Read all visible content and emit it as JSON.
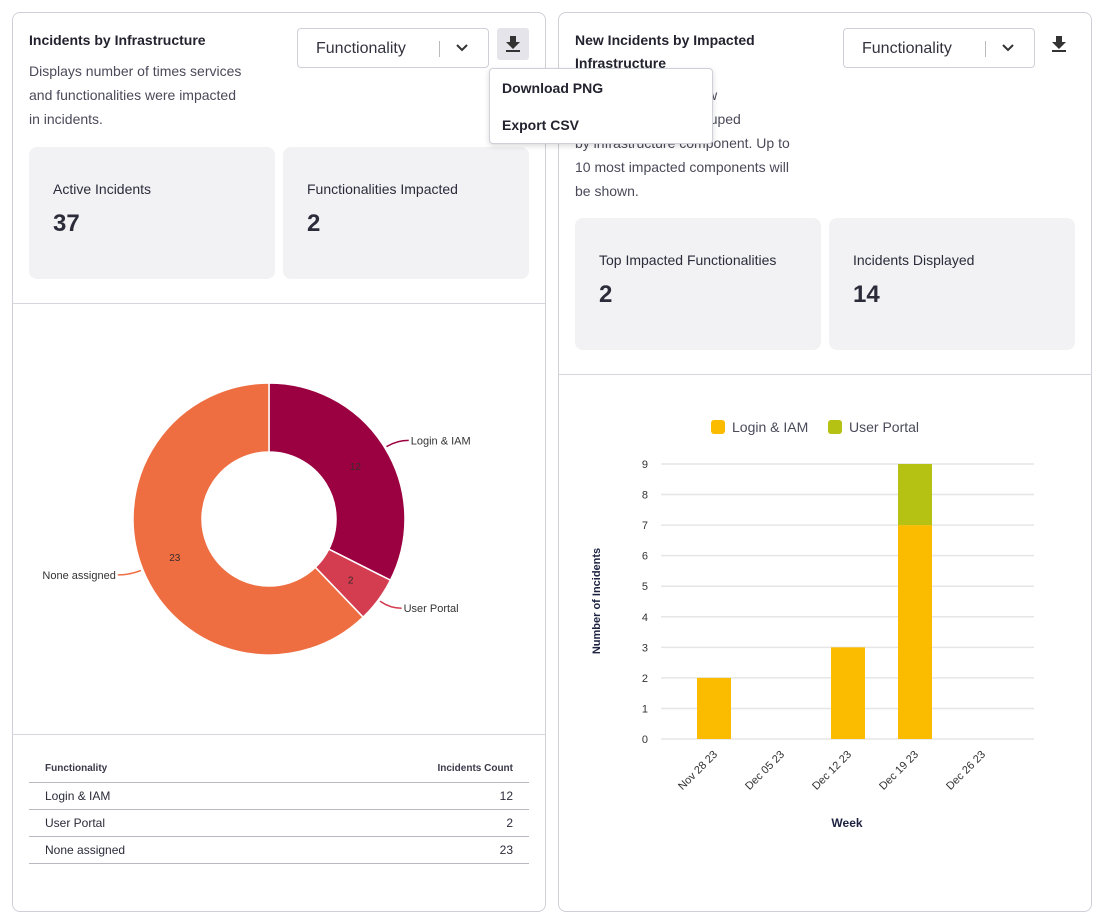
{
  "left_panel": {
    "title": "Incidents by Infrastructure",
    "description_lines": [
      "Displays number of times services",
      "and functionalities were impacted",
      "in incidents."
    ],
    "group_select": "Functionality",
    "download_icon": "download-icon",
    "download_menu": {
      "items": [
        "Download PNG",
        "Export CSV"
      ]
    },
    "stats": [
      {
        "label": "Active Incidents",
        "value": "37"
      },
      {
        "label": "Functionalities Impacted",
        "value": "2"
      }
    ],
    "table": {
      "headers": [
        "Functionality",
        "Incidents Count"
      ],
      "rows": [
        [
          "Login & IAM",
          "12"
        ],
        [
          "User Portal",
          "2"
        ],
        [
          "None assigned",
          "23"
        ]
      ]
    }
  },
  "right_panel": {
    "title_lines": [
      "New Incidents by Impacted",
      "Infrastructure"
    ],
    "description_visible_fragments": [
      "of new",
      "iod, grouped",
      "by infrastructure component. Up to",
      "10 most impacted components will",
      "be shown."
    ],
    "group_select": "Functionality",
    "download_icon": "download-icon",
    "stats": [
      {
        "label": "Top Impacted Functionalities",
        "value": "2"
      },
      {
        "label": "Incidents Displayed",
        "value": "14"
      }
    ]
  },
  "chart_data": [
    {
      "type": "pie",
      "variant": "donut",
      "slices": [
        {
          "label": "Login & IAM",
          "value": 12,
          "color": "#9b0040"
        },
        {
          "label": "User Portal",
          "value": 2,
          "color": "#d43c50"
        },
        {
          "label": "None assigned",
          "value": 23,
          "color": "#ee6e42"
        }
      ]
    },
    {
      "type": "bar",
      "stacked": true,
      "categories": [
        "Nov 28 23",
        "Dec 05 23",
        "Dec 12 23",
        "Dec 19 23",
        "Dec 26 23"
      ],
      "series": [
        {
          "name": "Login & IAM",
          "values": [
            2,
            0,
            3,
            7,
            0
          ],
          "color": "#fbbc00"
        },
        {
          "name": "User Portal",
          "values": [
            0,
            0,
            0,
            2,
            0
          ],
          "color": "#b5c214"
        }
      ],
      "xlabel": "Week",
      "ylabel": "Number of Incidents",
      "ylim": [
        0,
        9
      ],
      "yticks": [
        0,
        1,
        2,
        3,
        4,
        5,
        6,
        7,
        8,
        9
      ],
      "grid": true,
      "legend": "top"
    }
  ]
}
